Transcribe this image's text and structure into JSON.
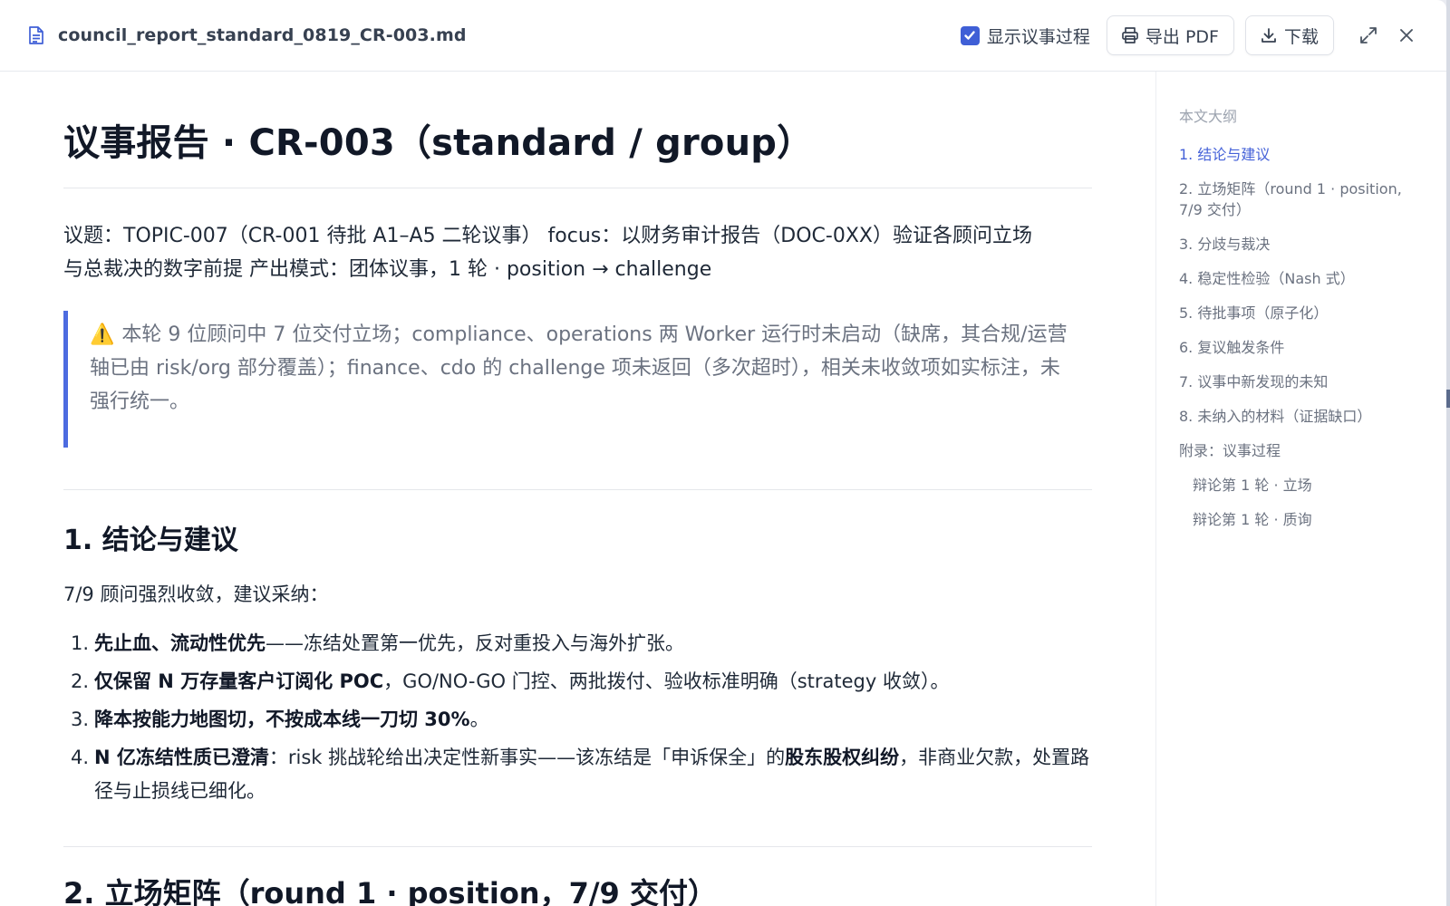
{
  "header": {
    "file_name": "council_report_standard_0819_CR-003.md",
    "show_process_label": "显示议事过程",
    "show_process_checked": true,
    "export_pdf_label": "导出 PDF",
    "download_label": "下载"
  },
  "doc": {
    "title": "议事报告 · CR-003（standard / group）",
    "meta_line1": "议题：TOPIC-007（CR-001 待批 A1–A5 二轮议事） focus：以财务审计报告（DOC-0XX）验证各顾问立场",
    "meta_line2": "与总裁决的数字前提 产出模式：团体议事，1 轮 · position → challenge",
    "notice": "本轮 9 位顾问中 7 位交付立场；compliance、operations 两 Worker 运行时未启动（缺席，其合规/运营轴已由 risk/org 部分覆盖）；finance、cdo 的 challenge 项未返回（多次超时），相关未收敛项如实标注，未强行统一。",
    "section1_title": "1. 结论与建议",
    "section1_intro": "7/9 顾问强烈收敛，建议采纳：",
    "items": [
      {
        "num": "1.",
        "bold": "先止血、流动性优先",
        "rest": "——冻结处置第一优先，反对重投入与海外扩张。"
      },
      {
        "num": "2.",
        "bold": "仅保留 N 万存量客户订阅化 POC",
        "rest": "，GO/NO-GO 门控、两批拨付、验收标准明确（strategy 收敛）。"
      },
      {
        "num": "3.",
        "bold": "降本按能力地图切，不按成本线一刀切 30%",
        "rest": "。"
      },
      {
        "num": "4.",
        "bold": "N 亿冻结性质已澄清",
        "rest": "：risk 挑战轮给出决定性新事实——该冻结是「申诉保全」的",
        "bold2": "股东股权纠纷",
        "rest2": "，非商业欠款，处置路径与止损线已细化。"
      }
    ],
    "section2_title": "2. 立场矩阵（round 1 · position，7/9 交付）"
  },
  "outline": {
    "title": "本文大纲",
    "items": [
      {
        "label": "1. 结论与建议",
        "active": true
      },
      {
        "label": "2. 立场矩阵（round 1 · position, 7/9 交付）"
      },
      {
        "label": "3. 分歧与裁决"
      },
      {
        "label": "4. 稳定性检验（Nash 式）"
      },
      {
        "label": "5. 待批事项（原子化）"
      },
      {
        "label": "6. 复议触发条件"
      },
      {
        "label": "7. 议事中新发现的未知"
      },
      {
        "label": "8. 未纳入的材料（证据缺口）"
      },
      {
        "label": "附录：议事过程"
      },
      {
        "label": "辩论第 1 轮 · 立场",
        "sub": true
      },
      {
        "label": "辩论第 1 轮 · 质询",
        "sub": true
      }
    ]
  },
  "colors": {
    "accent": "#3f5fd6",
    "outline_active": "#4461d8",
    "warning": "#e0a300"
  }
}
